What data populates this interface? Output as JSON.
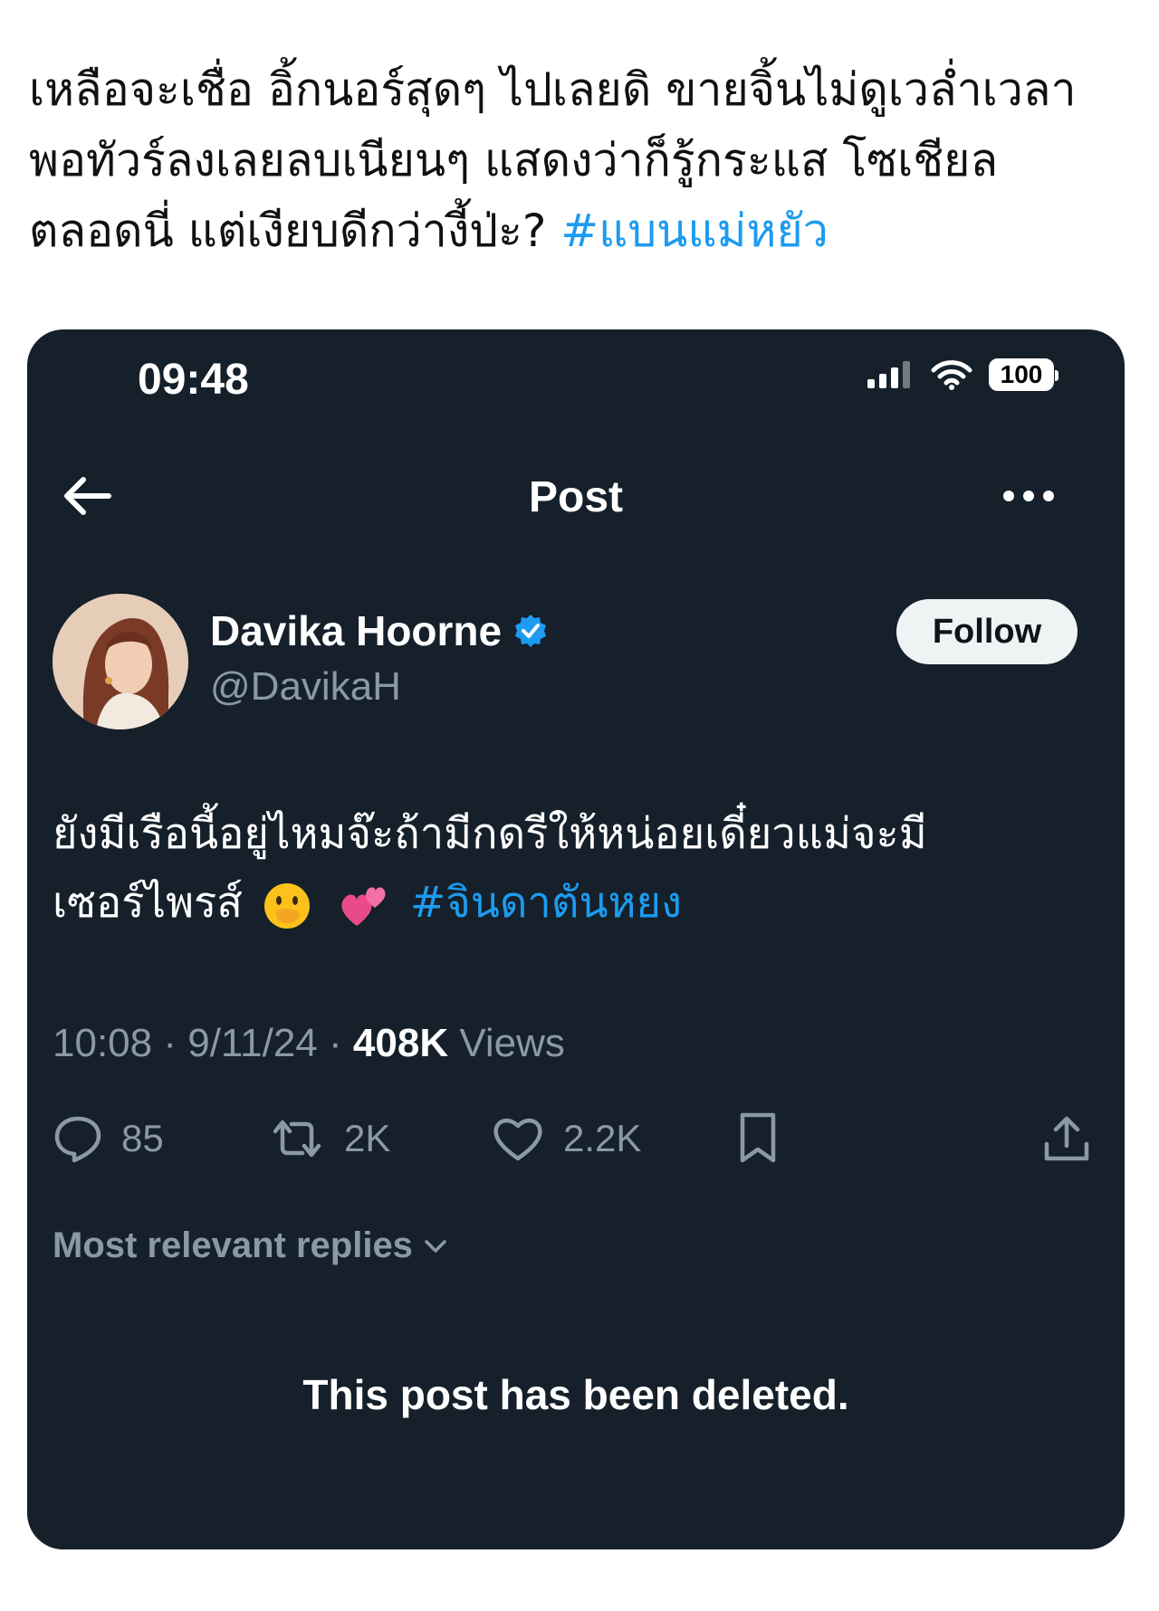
{
  "caption": {
    "line1": "เหลือจะเชื่อ อิ้กนอร์สุดๆ ไปเลยดิ ขายจิ้นไม่ดูเวล่ำเวลา",
    "line2": "พอทัวร์ลงเลยลบเนียนๆ แสดงว่าก็รู้กระแส โซเชียล",
    "line3": "ตลอดนี่ แต่เงียบดีกว่างี้ป่ะ?",
    "hashtag": "#แบนแม่หยัว"
  },
  "status_bar": {
    "time": "09:48",
    "battery": "100"
  },
  "nav": {
    "title": "Post"
  },
  "author": {
    "name": "Davika Hoorne",
    "handle": "@DavikaH",
    "verified": true
  },
  "follow_label": "Follow",
  "post": {
    "line1": "ยังมีเรือนี้อยู่ไหมจ๊ะถ้ามีกดรีให้หน่อยเดี๋ยวแม่จะมี",
    "line2": "เซอร์ไพรส์",
    "emojis": [
      "face-with-hand-over-mouth",
      "two-hearts"
    ],
    "hashtag": "#จินดาตันหยง"
  },
  "meta": {
    "time": "10:08",
    "date": "9/11/24",
    "views_count": "408K",
    "views_label": "Views",
    "separator": "·"
  },
  "actions": {
    "replies": "85",
    "reposts": "2K",
    "likes": "2.2K"
  },
  "replies_sort_label": "Most relevant replies",
  "deleted_notice": "This post has been deleted.",
  "colors": {
    "background": "#15202b",
    "link": "#1d9bf0",
    "muted": "#8b98a5"
  }
}
